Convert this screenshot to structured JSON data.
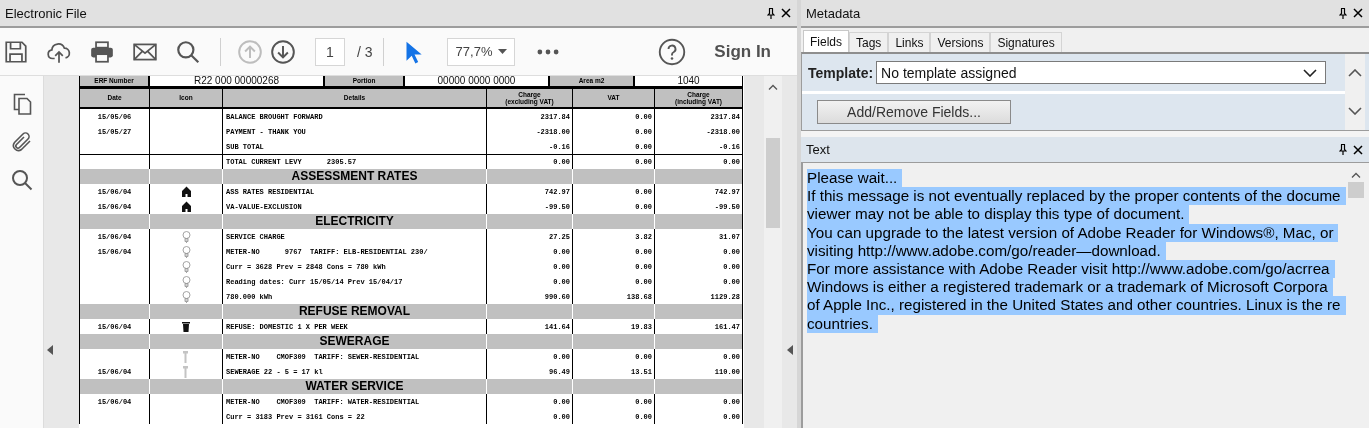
{
  "viewer": {
    "title": "Electronic File"
  },
  "toolbar": {
    "previous_page": {
      "disabled": true
    },
    "next_page": {
      "disabled": false
    },
    "page_field": {
      "value": "1"
    },
    "page_total": "/ 3",
    "select_tool": {
      "selected": true
    },
    "zoom": {
      "value": "77,7%"
    },
    "sign_in": "Sign In"
  },
  "document": {
    "property_cells": [
      {
        "kind": "label",
        "text": "ERF Number"
      },
      {
        "kind": "value",
        "text": "R22 000 00000268"
      },
      {
        "kind": "label",
        "text": "Portion"
      },
      {
        "kind": "value",
        "text": "00000 0000 0000"
      },
      {
        "kind": "label",
        "text": "Area m2"
      },
      {
        "kind": "value",
        "text": "1040"
      }
    ],
    "columns": [
      {
        "label": "Date"
      },
      {
        "label": "Icon"
      },
      {
        "label": "Details"
      },
      {
        "label": "Charge",
        "sublabel": "(excluding VAT)"
      },
      {
        "label": "VAT"
      },
      {
        "label": "Charge",
        "sublabel": "(including VAT)"
      }
    ],
    "rows": [
      {
        "kind": "item",
        "date": "15/05/06",
        "details": "BALANCE BROUGHT FORWARD",
        "excl": "2317.84",
        "vat": "0.00",
        "incl": "2317.84"
      },
      {
        "kind": "item",
        "date": "15/05/27",
        "details": "PAYMENT - THANK YOU",
        "excl": "-2318.00",
        "vat": "0.00",
        "incl": "-2318.00"
      },
      {
        "kind": "item",
        "details": "SUB TOTAL",
        "excl": "-0.16",
        "vat": "0.00",
        "incl": "-0.16"
      },
      {
        "kind": "total",
        "details": "TOTAL CURRENT LEVY      2305.57",
        "excl": "0.00",
        "vat": "0.00",
        "incl": "0.00"
      },
      {
        "kind": "section",
        "title": "ASSESSMENT RATES"
      },
      {
        "kind": "item",
        "date": "15/06/04",
        "details": "ASS RATES RESIDENTIAL",
        "excl": "742.97",
        "vat": "0.00",
        "incl": "742.97"
      },
      {
        "kind": "item",
        "date": "15/06/04",
        "details": "VA-VALUE-EXCLUSION",
        "excl": "-99.50",
        "vat": "0.00",
        "incl": "-99.50"
      },
      {
        "kind": "section",
        "title": "ELECTRICITY"
      },
      {
        "kind": "item",
        "date": "15/06/04",
        "details": "SERVICE CHARGE",
        "excl": "27.25",
        "vat": "3.82",
        "incl": "31.07"
      },
      {
        "kind": "item",
        "date": "15/06/04",
        "details": "METER-NO      9767  TARIFF: ELB-RESIDENTIAL 230/",
        "excl": "0.00",
        "vat": "0.00",
        "incl": "0.00"
      },
      {
        "kind": "item",
        "details": "Curr = 3628 Prev = 2848 Cons = 780 kWh",
        "excl": "0.00",
        "vat": "0.00",
        "incl": "0.00"
      },
      {
        "kind": "item",
        "details": "Reading dates: Curr 15/05/14 Prev 15/04/17",
        "excl": "0.00",
        "vat": "0.00",
        "incl": "0.00"
      },
      {
        "kind": "item",
        "details": "780.000 kWh",
        "excl": "990.60",
        "vat": "138.68",
        "incl": "1129.28"
      },
      {
        "kind": "section",
        "title": "REFUSE REMOVAL"
      },
      {
        "kind": "item",
        "date": "15/06/04",
        "details": "REFUSE: DOMESTIC 1 X PER WEEK",
        "excl": "141.64",
        "vat": "19.83",
        "incl": "161.47"
      },
      {
        "kind": "section",
        "title": "SEWERAGE"
      },
      {
        "kind": "item",
        "details": "METER-NO    CMOF309  TARIFF: SEWER-RESIDENTIAL",
        "excl": "0.00",
        "vat": "0.00",
        "incl": "0.00"
      },
      {
        "kind": "item",
        "date": "15/06/04",
        "details": "SEWERAGE 22 - 5 = 17 kl",
        "excl": "96.49",
        "vat": "13.51",
        "incl": "110.00"
      },
      {
        "kind": "section",
        "title": "WATER SERVICE"
      },
      {
        "kind": "item",
        "date": "15/06/04",
        "details": "METER-NO    CMOF309  TARIFF: WATER-RESIDENTIAL",
        "excl": "0.00",
        "vat": "0.00",
        "incl": "0.00"
      },
      {
        "kind": "item",
        "details": "Curr = 3183 Prev = 3161 Cons = 22",
        "excl": "0.00",
        "vat": "0.00",
        "incl": "0.00"
      }
    ]
  },
  "metadata": {
    "title": "Metadata",
    "tabs": [
      {
        "label": "Fields",
        "selected": true
      },
      {
        "label": "Tags",
        "selected": false
      },
      {
        "label": "Links",
        "selected": false
      },
      {
        "label": "Versions",
        "selected": false
      },
      {
        "label": "Signatures",
        "selected": false
      }
    ],
    "template": {
      "label": "Template:",
      "value": "No template assigned"
    },
    "add_remove_button": "Add/Remove Fields..."
  },
  "text_panel": {
    "title": "Text",
    "selected": true,
    "lines": [
      "Please wait...",
      "If this message is not eventually replaced by the proper contents of the docume",
      "viewer may not be able to display this type of document.",
      "You can upgrade to the latest version of Adobe Reader for Windows®, Mac, or",
      "visiting http://www.adobe.com/go/reader—download.",
      "For more assistance with Adobe Reader visit http://www.adobe.com/go/acrrea",
      "Windows is either a registered trademark or a trademark of Microsoft Corpora",
      "of Apple Inc., registered in the United States and other countries. Linux is the re",
      "countries."
    ]
  }
}
